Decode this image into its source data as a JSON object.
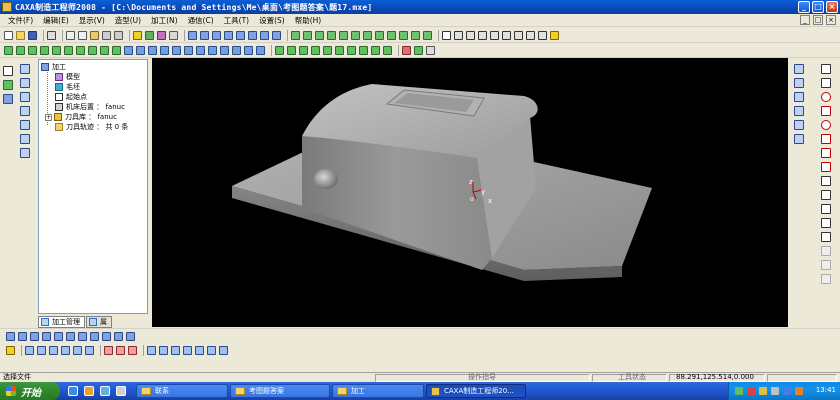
{
  "window": {
    "title": "CAXA制造工程师2008  - [C:\\Documents and Settings\\Me\\桌面\\考图题答案\\题17.mxe]",
    "controls": [
      "_",
      "□",
      "×"
    ]
  },
  "menu": {
    "items": [
      "文件(F)",
      "编辑(E)",
      "显示(V)",
      "造型(U)",
      "加工(N)",
      "通信(C)",
      "工具(T)",
      "设置(S)",
      "帮助(H)"
    ]
  },
  "tree": {
    "root_label": "加工",
    "nodes": [
      {
        "label": "模型",
        "icon": "model-icon"
      },
      {
        "label": "毛坯",
        "icon": "stock-icon"
      },
      {
        "label": "起始点",
        "icon": "start-point-icon"
      },
      {
        "label": "机床后置 ： fanuc",
        "icon": "machine-post-icon"
      },
      {
        "label": "刀具库 ： fanuc",
        "icon": "tool-library-icon"
      },
      {
        "label": "刀具轨迹 ： 共 0 条",
        "icon": "toolpath-icon"
      }
    ],
    "tabs": [
      "加工管理",
      "属"
    ]
  },
  "axes": {
    "z": "z",
    "y": "y",
    "x": "x",
    "origin": "o"
  },
  "status": {
    "left": "选择文件",
    "prompt": "操作指导",
    "tool_state": "工具状态",
    "coords": "88.291,125.514,0.000"
  },
  "taskbar": {
    "start_label": "开始",
    "tasks": [
      {
        "label": "联系",
        "kind": "folder"
      },
      {
        "label": "考图题答案",
        "kind": "folder"
      },
      {
        "label": "加工",
        "kind": "folder"
      },
      {
        "label": "CAXA制造工程师20...",
        "kind": "app"
      }
    ],
    "clock": "13:41"
  },
  "colors": {
    "titlebar": "#0a5fd8",
    "viewport_bg": "#000000",
    "model_gray": "#8c8c8c",
    "taskbar": "#245edb",
    "start_green": "#2f8a2f"
  }
}
